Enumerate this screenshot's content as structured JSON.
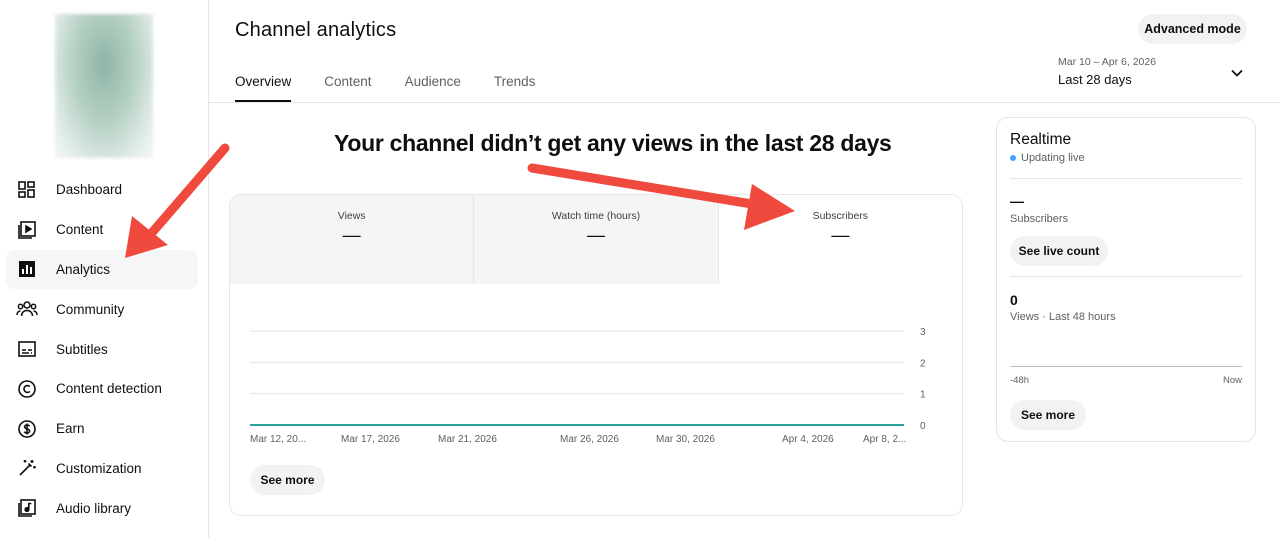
{
  "sidebar": {
    "items": [
      {
        "label": "Dashboard",
        "icon": "dashboard-icon"
      },
      {
        "label": "Content",
        "icon": "content-icon"
      },
      {
        "label": "Analytics",
        "icon": "analytics-icon",
        "active": true
      },
      {
        "label": "Community",
        "icon": "community-icon"
      },
      {
        "label": "Subtitles",
        "icon": "subtitles-icon"
      },
      {
        "label": "Content detection",
        "icon": "copyright-icon"
      },
      {
        "label": "Earn",
        "icon": "dollar-icon"
      },
      {
        "label": "Customization",
        "icon": "magic-wand-icon"
      },
      {
        "label": "Audio library",
        "icon": "audio-library-icon"
      }
    ]
  },
  "header": {
    "title": "Channel analytics",
    "tabs": [
      {
        "label": "Overview",
        "active": true
      },
      {
        "label": "Content"
      },
      {
        "label": "Audience"
      },
      {
        "label": "Trends"
      }
    ],
    "advanced_mode": "Advanced mode",
    "date_range": {
      "dates": "Mar 10 – Apr 6, 2026",
      "period": "Last 28 days"
    }
  },
  "headline": "Your channel didn’t get any views in the last 28 days",
  "metrics": [
    {
      "label": "Views",
      "value": "—"
    },
    {
      "label": "Watch time (hours)",
      "value": "—"
    },
    {
      "label": "Subscribers",
      "value": "—",
      "selected": true
    }
  ],
  "chart_data": {
    "type": "line",
    "x": [
      "Mar 12, 20...",
      "Mar 17, 2026",
      "Mar 21, 2026",
      "Mar 26, 2026",
      "Mar 30, 2026",
      "Apr 4, 2026",
      "Apr 8, 2..."
    ],
    "series": [
      {
        "values": [
          0,
          0,
          0,
          0,
          0,
          0,
          0
        ],
        "color": "#2ba39a"
      }
    ],
    "y_ticks": [
      "0",
      "1",
      "2",
      "3"
    ],
    "ylim": [
      0,
      3
    ],
    "grid": true,
    "title": "",
    "xlabel": "",
    "ylabel": ""
  },
  "see_more": "See more",
  "realtime": {
    "title": "Realtime",
    "status": "Updating live",
    "subscribers_value": "—",
    "subscribers_label": "Subscribers",
    "live_count_button": "See live count",
    "views_value": "0",
    "views_label": "Views · Last 48 hours",
    "axis_start": "-48h",
    "axis_end": "Now",
    "see_more": "See more"
  },
  "colors": {
    "annotation_arrow": "#f04a3e",
    "live_dot": "#3ea6ff",
    "series": "#2ba39a"
  }
}
